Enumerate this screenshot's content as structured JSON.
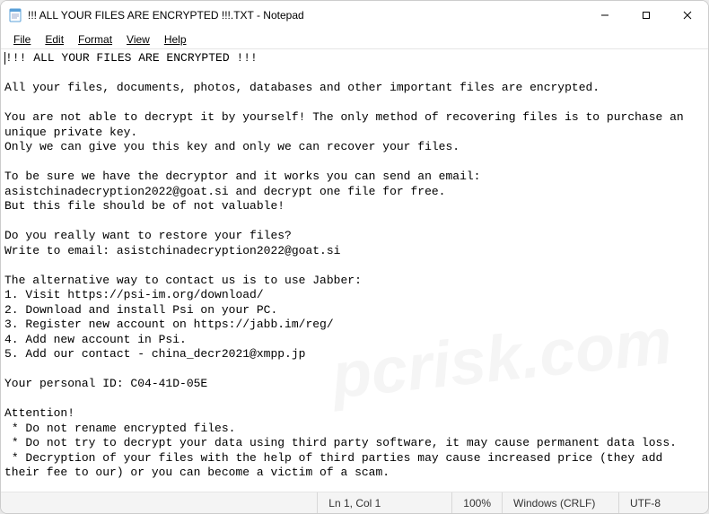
{
  "titlebar": {
    "icon_name": "notepad-icon",
    "title": "!!! ALL YOUR FILES ARE ENCRYPTED !!!.TXT - Notepad"
  },
  "window_controls": {
    "minimize": "—",
    "maximize": "☐",
    "close": "✕"
  },
  "menubar": {
    "file": "File",
    "edit": "Edit",
    "format": "Format",
    "view": "View",
    "help": "Help"
  },
  "document": {
    "text": "!!! ALL YOUR FILES ARE ENCRYPTED !!!\n\nAll your files, documents, photos, databases and other important files are encrypted.\n\nYou are not able to decrypt it by yourself! The only method of recovering files is to purchase an unique private key.\nOnly we can give you this key and only we can recover your files.\n\nTo be sure we have the decryptor and it works you can send an email: asistchinadecryption2022@goat.si and decrypt one file for free.\nBut this file should be of not valuable!\n\nDo you really want to restore your files?\nWrite to email: asistchinadecryption2022@goat.si\n\nThe alternative way to contact us is to use Jabber:\n1. Visit https://psi-im.org/download/\n2. Download and install Psi on your PC.\n3. Register new account on https://jabb.im/reg/\n4. Add new account in Psi.\n5. Add our contact - china_decr2021@xmpp.jp\n\nYour personal ID: C04-41D-05E\n\nAttention!\n * Do not rename encrypted files.\n * Do not try to decrypt your data using third party software, it may cause permanent data loss.\n * Decryption of your files with the help of third parties may cause increased price (they add their fee to our) or you can become a victim of a scam."
  },
  "statusbar": {
    "position": "Ln 1, Col 1",
    "zoom": "100%",
    "lineending": "Windows (CRLF)",
    "encoding": "UTF-8"
  },
  "watermark": "pcrisk.com"
}
